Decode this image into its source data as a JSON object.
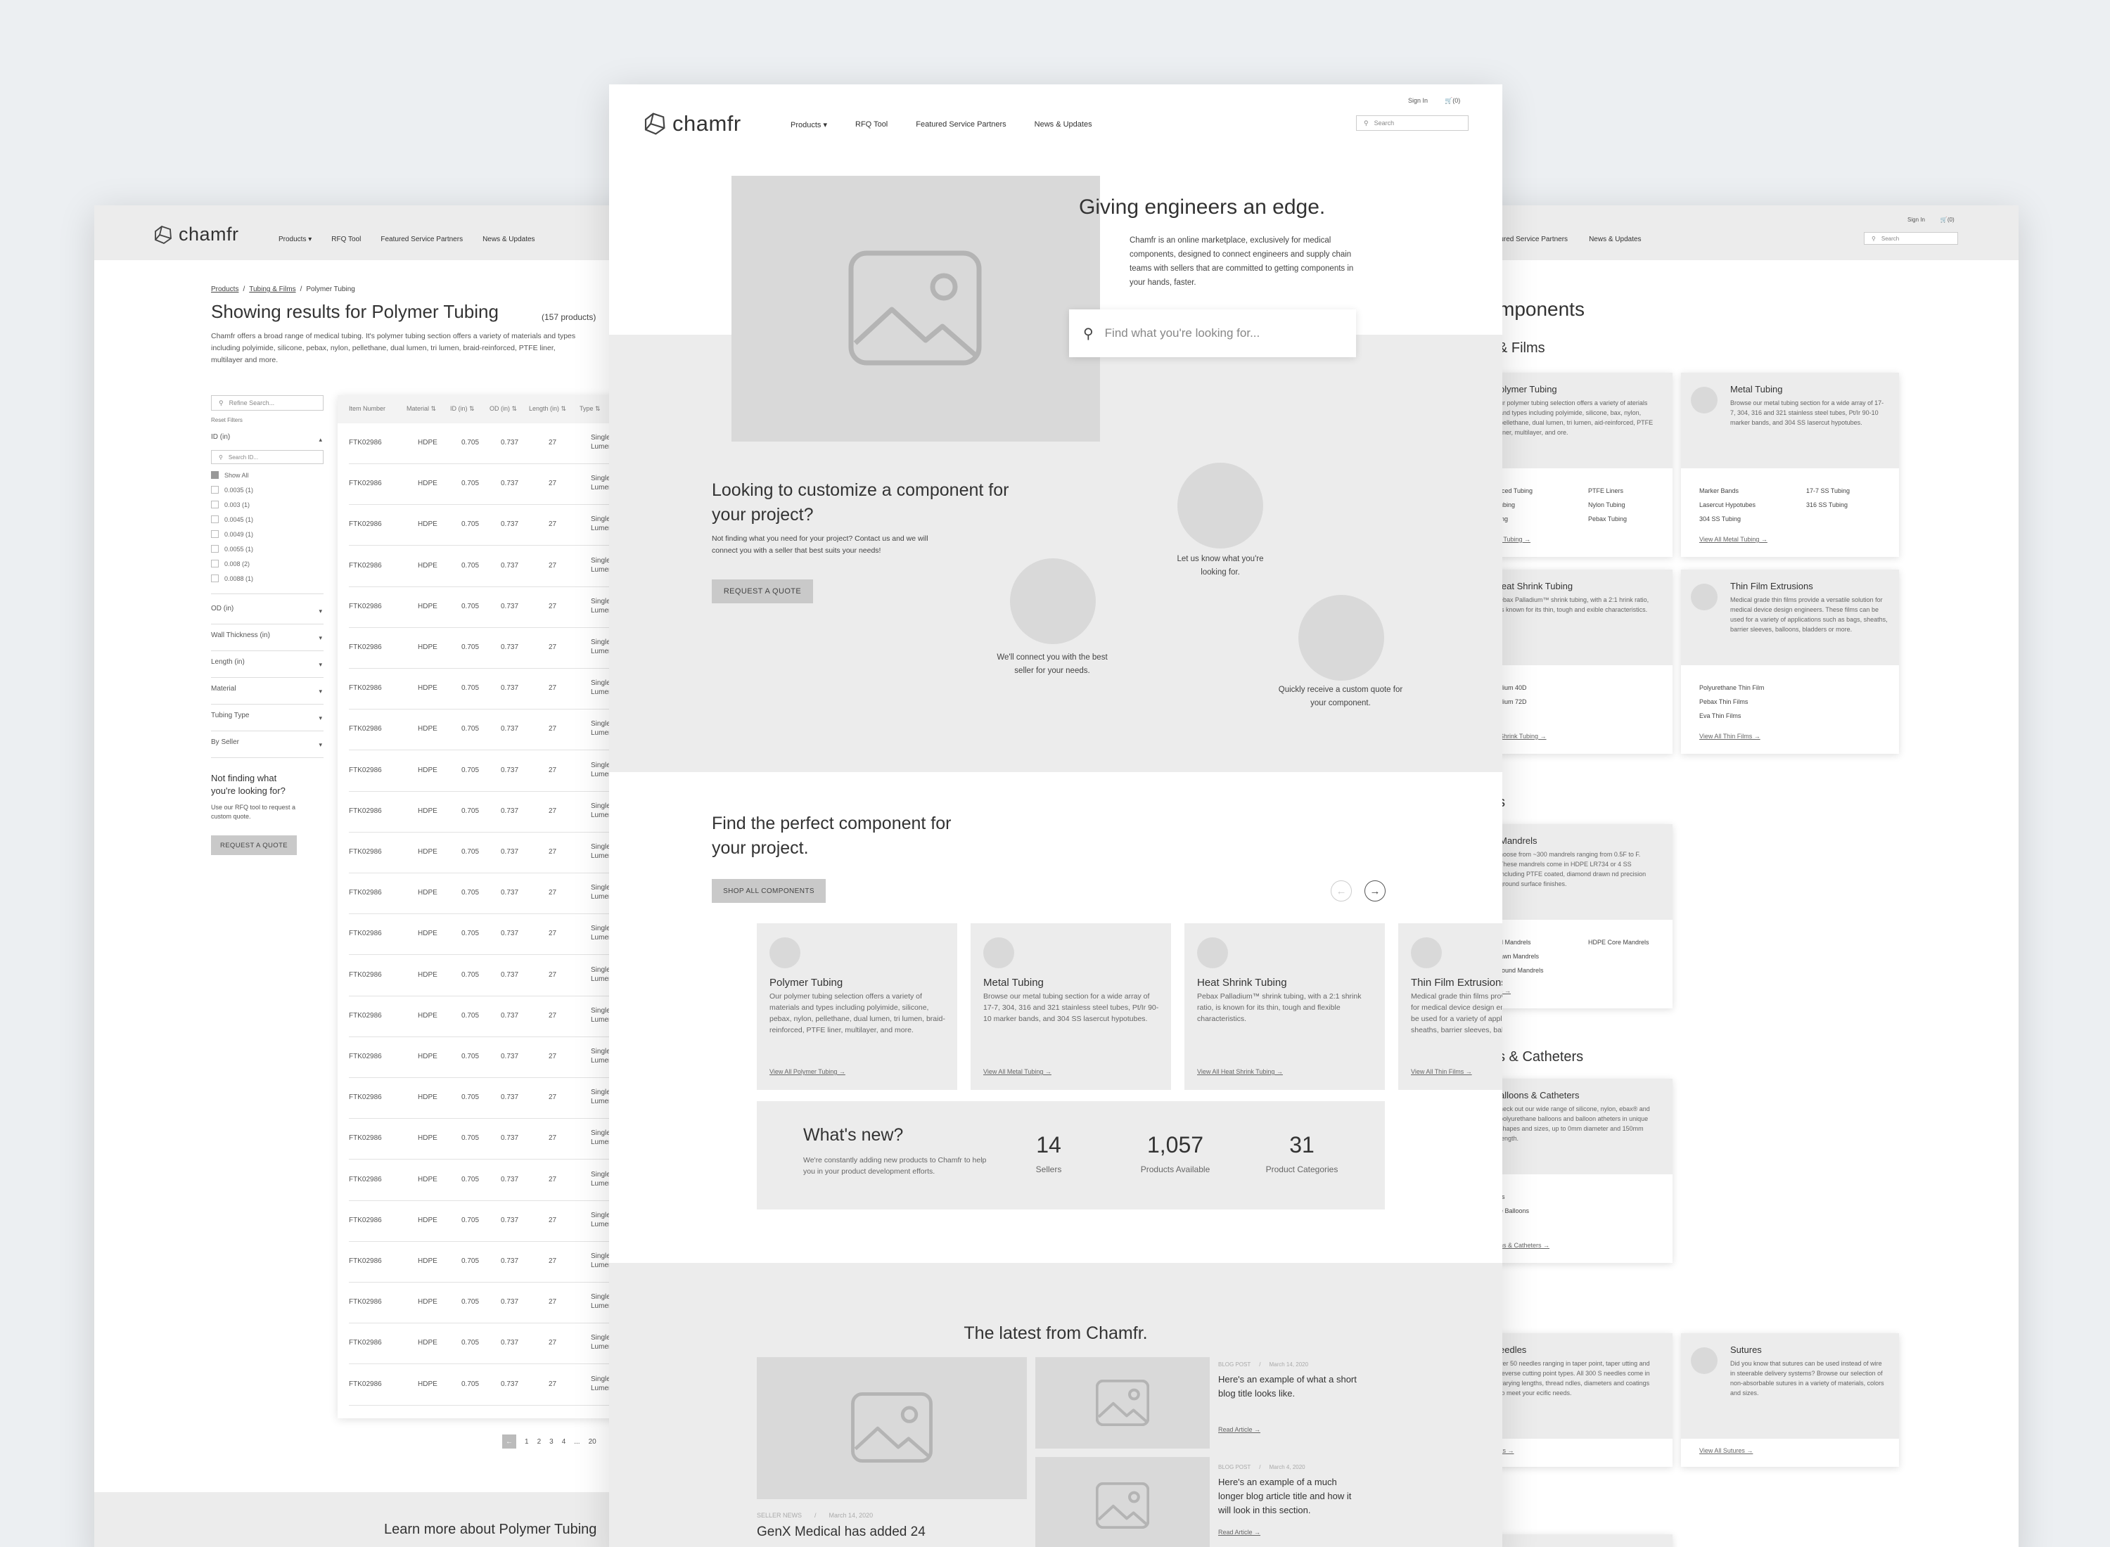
{
  "brand": {
    "name": "chamfr"
  },
  "nav": {
    "products": "Products",
    "rfq": "RFQ Tool",
    "fsp": "Featured Service Partners",
    "news": "News & Updates",
    "fsp_partial": "atured Service Partners"
  },
  "header": {
    "sign_in": "Sign In",
    "cart": "(0)",
    "search_placeholder": "Search"
  },
  "left_page": {
    "breadcrumb": {
      "products": "Products",
      "tubing": "Tubing & Films",
      "current": "Polymer Tubing",
      "sep": "/"
    },
    "title": "Showing results for Polymer Tubing",
    "count": "(157 products)",
    "description": "Chamfr offers a broad range of medical tubing. It's polymer tubing section offers a variety of materials and types including polyimide, silicone, pebax, nylon, pellethane, dual lumen, tri lumen, braid-reinforced, PTFE liner, multilayer and more.",
    "refine_placeholder": "Refine Search...",
    "reset": "Reset Filters",
    "filter_id": "ID (in)",
    "search_id_placeholder": "Search ID...",
    "show_all": "Show All",
    "id_options": [
      "0.0035 (1)",
      "0.003 (1)",
      "0.0045 (1)",
      "0.0049 (1)",
      "0.0055 (1)",
      "0.008 (2)",
      "0.0088 (1)"
    ],
    "filters": [
      "OD (in)",
      "Wall Thickness (in)",
      "Length (in)",
      "Material",
      "Tubing Type",
      "By Seller"
    ],
    "not_finding_title": "Not finding what you're looking for?",
    "not_finding_body": "Use our RFQ tool to request a custom quote.",
    "request_quote": "REQUEST A QUOTE",
    "columns": [
      "Item Number",
      "Material ⇅",
      "ID (in) ⇅",
      "OD (in) ⇅",
      "Length (in) ⇅",
      "Type ⇅"
    ],
    "row": {
      "item": "FTK02986",
      "material": "HDPE",
      "id": "0.705",
      "od": "0.737",
      "length": "27",
      "type_1": "Single",
      "type_2": "Lumen"
    },
    "pagination": [
      "1",
      "2",
      "3",
      "4",
      "...",
      "20"
    ],
    "learn_more": "Learn more about Polymer Tubing"
  },
  "hero": {
    "title": "Giving engineers an edge.",
    "body": "Chamfr is an online marketplace, exclusively for medical components, designed to connect engineers and supply chain teams with sellers that are committed to getting components in your hands, faster.",
    "search_placeholder": "Find what you're looking for..."
  },
  "customize": {
    "title": "Looking to customize a component for your project?",
    "body": "Not finding what you need for your project? Contact us and we will connect you with a seller that best suits your needs!",
    "button": "REQUEST A QUOTE",
    "step1": "Let us know what you're looking for.",
    "step2": "We'll connect you with the best seller for your needs.",
    "step3": "Quickly receive a custom quote for your component."
  },
  "find": {
    "title": "Find the perfect component for your project.",
    "button": "SHOP ALL COMPONENTS",
    "prev": "←",
    "next": "→",
    "cards": [
      {
        "title": "Polymer Tubing",
        "desc": "Our polymer tubing selection offers a variety of materials and types including polyimide, silicone, pebax, nylon, pellethane, dual lumen, tri lumen, braid-reinforced, PTFE liner, multilayer, and more.",
        "link": "View All Polymer Tubing →"
      },
      {
        "title": "Metal Tubing",
        "desc": "Browse our metal tubing section for a wide array of 17-7, 304, 316 and 321 stainless steel tubes, Pt/Ir 90-10 marker bands, and 304 SS lasercut hypotubes.",
        "link": "View All Metal Tubing →"
      },
      {
        "title": "Heat Shrink Tubing",
        "desc": "Pebax Palladium™ shrink tubing, with a 2:1 shrink ratio, is known for its thin, tough and flexible characteristics.",
        "link": "View All Heat Shrink Tubing →"
      },
      {
        "title": "Thin Film Extrusions",
        "desc": "Medical grade thin films provide a versatile solution for medical device design engineers. These films can be used for a variety of applications such as bags, sheaths, barrier sleeves, balloons, bladders or more.",
        "link": "View All Thin Films →"
      }
    ]
  },
  "whats_new": {
    "title": "What's new?",
    "body": "We're constantly adding new products to Chamfr to help you in your product development efforts.",
    "stats": [
      {
        "n": "14",
        "l": "Sellers"
      },
      {
        "n": "1,057",
        "l": "Products Available"
      },
      {
        "n": "31",
        "l": "Product Categories"
      }
    ]
  },
  "latest": {
    "title": "The latest from Chamfr.",
    "feature_tag": "SELLER NEWS",
    "feature_date": "March 14, 2020",
    "feature_title": "GenX Medical has added 24",
    "posts": [
      {
        "tag": "BLOG POST",
        "date": "March 14, 2020",
        "title": "Here's an example of what a short blog title looks like.",
        "link": "Read Article →"
      },
      {
        "tag": "BLOG POST",
        "date": "March 4, 2020",
        "title": "Here's an example of a much longer blog article title and how it will look in this section.",
        "link": "Read Article →"
      }
    ]
  },
  "right_page": {
    "title_partial": "mponents",
    "section1": "& Films",
    "polymer": {
      "title": "olymer Tubing",
      "desc": "ur polymer tubing selection offers a variety of aterials and types including polyimide, silicone, bax, nylon, pellethane, dual lumen, tri lumen, aid-reinforced, PTFE liner, multilayer, and ore.",
      "links_a": [
        "rced Tubing",
        "ubing",
        "ing"
      ],
      "links_b": [
        "PTFE Liners",
        "Nylon Tubing",
        "Pebax Tubing"
      ],
      "view": "r Tubing →"
    },
    "metal": {
      "title": "Metal Tubing",
      "desc": "Browse our metal tubing section for a wide array of 17-7, 304, 316 and 321 stainless steel tubes, Pt/Ir 90-10 marker bands, and 304 SS lasercut hypotubes.",
      "links_a": [
        "Marker Bands",
        "Lasercut Hypotubes",
        "304 SS Tubing"
      ],
      "links_b": [
        "17-7 SS Tubing",
        "316 SS Tubing"
      ],
      "view": "View All Metal Tubing →"
    },
    "heat": {
      "title": "leat Shrink Tubing",
      "desc": "ebax Palladium™ shrink tubing, with a 2:1 hrink ratio, is known for its thin, tough and exible characteristics.",
      "links_a": [
        "dium 40D",
        "dium 72D"
      ],
      "view": "Shrink Tubing →"
    },
    "thin": {
      "title": "Thin Film Extrusions",
      "desc": "Medical grade thin films provide a versatile solution for medical device design engineers. These films can be used for a variety of applications such as bags, sheaths, barrier sleeves, balloons, bladders or more.",
      "links_a": [
        "Polyurethane Thin Film",
        "Pebax Thin Films",
        "Eva Thin Films"
      ],
      "view": "View All Thin Films →"
    },
    "section2": "s",
    "mandrels": {
      "title": "Mandrels",
      "desc": "hoose from ~300 mandrels ranging from 0.5F to F. These mandrels come in HDPE LR734 or 4 SS including PTFE coated, diamond drawn nd precision ground surface finishes.",
      "links_a": [
        "d Mandrels",
        "awn Mandrels",
        "round Mandrels"
      ],
      "links_b": [
        "HDPE Core Mandrels"
      ],
      "view": "s →"
    },
    "section3": "s & Catheters",
    "balloons": {
      "title": "alloons & Catheters",
      "desc": "heck out our wide range of silicone, nylon, ebax® and polyurethane balloons and balloon atheters in unique shapes and sizes, up to 0mm diameter and 150mm length.",
      "links_a": [
        "rs",
        "e Balloons"
      ],
      "view": "ns & Catheters →"
    },
    "needles": {
      "title": "eedles",
      "desc": "ver 50 needles ranging in taper point, taper utting and reverse cutting point types. All 300 S needles come in varying lengths, thread ndles, diameters and coatings to meet your ecific needs.",
      "view": "ks →"
    },
    "sutures": {
      "title": "Sutures",
      "desc": "Did you know that sutures can be used instead of wire in steerable delivery systems? Browse our selection of non-absorbable sutures in a variety of materials, colors and sizes.",
      "view": "View All Sutures →"
    }
  }
}
